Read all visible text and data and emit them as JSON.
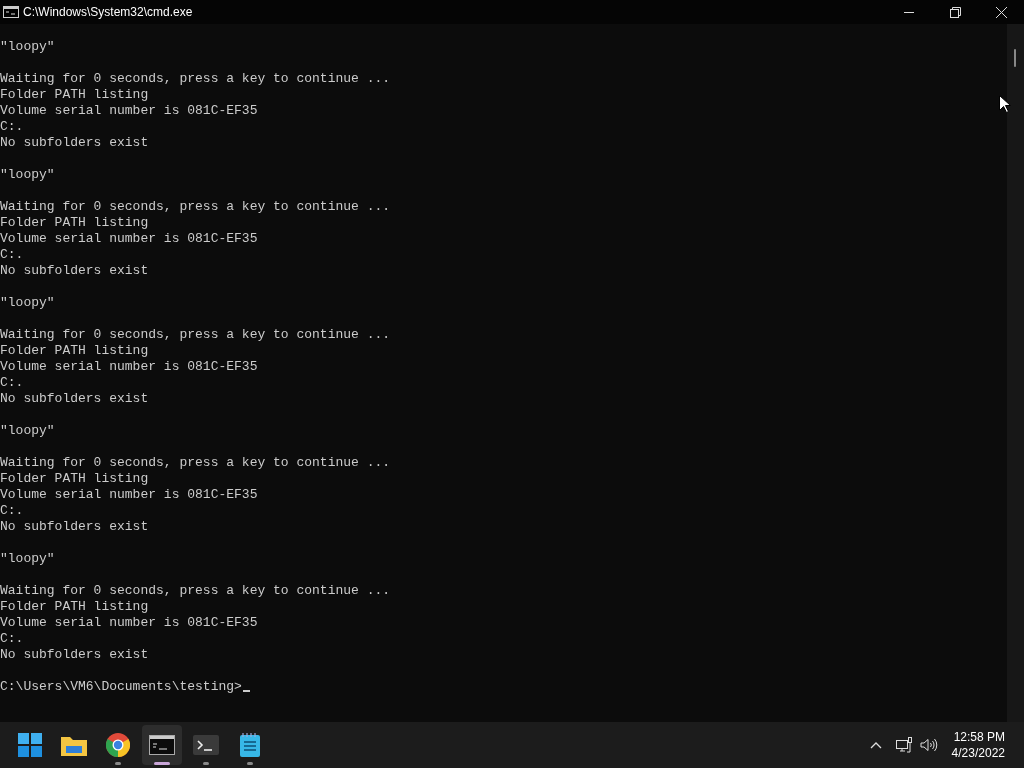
{
  "window": {
    "title": "C:\\Windows\\System32\\cmd.exe"
  },
  "console": {
    "blocks": [
      {
        "lines": [
          "\"loopy\""
        ]
      },
      {
        "lines": [
          "Waiting for 0 seconds, press a key to continue ...",
          "Folder PATH listing",
          "Volume serial number is 081C-EF35",
          "C:.",
          "No subfolders exist"
        ]
      },
      {
        "lines": [
          "\"loopy\""
        ]
      },
      {
        "lines": [
          "Waiting for 0 seconds, press a key to continue ...",
          "Folder PATH listing",
          "Volume serial number is 081C-EF35",
          "C:.",
          "No subfolders exist"
        ]
      },
      {
        "lines": [
          "\"loopy\""
        ]
      },
      {
        "lines": [
          "Waiting for 0 seconds, press a key to continue ...",
          "Folder PATH listing",
          "Volume serial number is 081C-EF35",
          "C:.",
          "No subfolders exist"
        ]
      },
      {
        "lines": [
          "\"loopy\""
        ]
      },
      {
        "lines": [
          "Waiting for 0 seconds, press a key to continue ...",
          "Folder PATH listing",
          "Volume serial number is 081C-EF35",
          "C:.",
          "No subfolders exist"
        ]
      },
      {
        "lines": [
          "\"loopy\""
        ]
      },
      {
        "lines": [
          "Waiting for 0 seconds, press a key to continue ...",
          "Folder PATH listing",
          "Volume serial number is 081C-EF35",
          "C:.",
          "No subfolders exist"
        ]
      }
    ],
    "prompt": "C:\\Users\\VM6\\Documents\\testing>"
  },
  "taskbar": {
    "apps": [
      {
        "kind": "start",
        "running": false,
        "active": false
      },
      {
        "kind": "folder",
        "running": false,
        "active": false
      },
      {
        "kind": "browser",
        "running": true,
        "active": false
      },
      {
        "kind": "console",
        "running": true,
        "active": true
      },
      {
        "kind": "terminal",
        "running": true,
        "active": false
      },
      {
        "kind": "notepad",
        "running": true,
        "active": false
      }
    ],
    "time": "12:58 PM",
    "date": "4/23/2022"
  }
}
